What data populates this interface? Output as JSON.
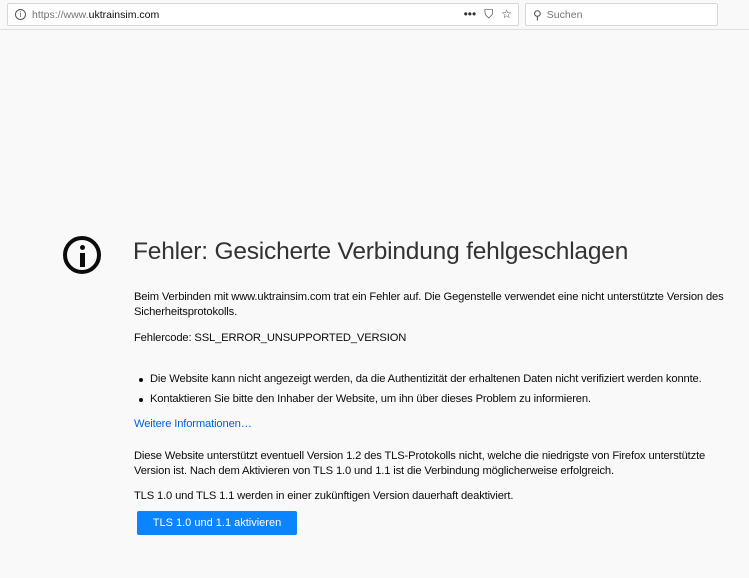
{
  "browser": {
    "url_prefix": "https://www.",
    "url_domain": "uktrainsim.com",
    "search_placeholder": "Suchen",
    "more_icon": "•••",
    "pocket_icon": "⛉",
    "bookmark_icon": "☆"
  },
  "error": {
    "title": "Fehler: Gesicherte Verbindung fehlgeschlagen",
    "intro": "Beim Verbinden mit www.uktrainsim.com trat ein Fehler auf. Die Gegenstelle verwendet eine nicht unterstützte Version des Sicherheitsprotokolls.",
    "code": "Fehlercode: SSL_ERROR_UNSUPPORTED_VERSION",
    "bullets": [
      "Die Website kann nicht angezeigt werden, da die Authentizität der erhaltenen Daten nicht verifiziert werden konnte.",
      "Kontaktieren Sie bitte den Inhaber der Website, um ihn über dieses Problem zu informieren."
    ],
    "more_info": "Weitere Informationen…",
    "tls_note": "Diese Website unterstützt eventuell Version 1.2 des TLS-Protokolls nicht, welche die niedrigste von Firefox unterstützte Version ist. Nach dem Aktivieren von TLS 1.0 und 1.1 ist die Verbindung möglicherweise erfolgreich.",
    "deprecation": "TLS 1.0 und TLS 1.1 werden in einer zukünftigen Version dauerhaft deaktiviert.",
    "button": "TLS 1.0 und 1.1 aktivieren"
  }
}
